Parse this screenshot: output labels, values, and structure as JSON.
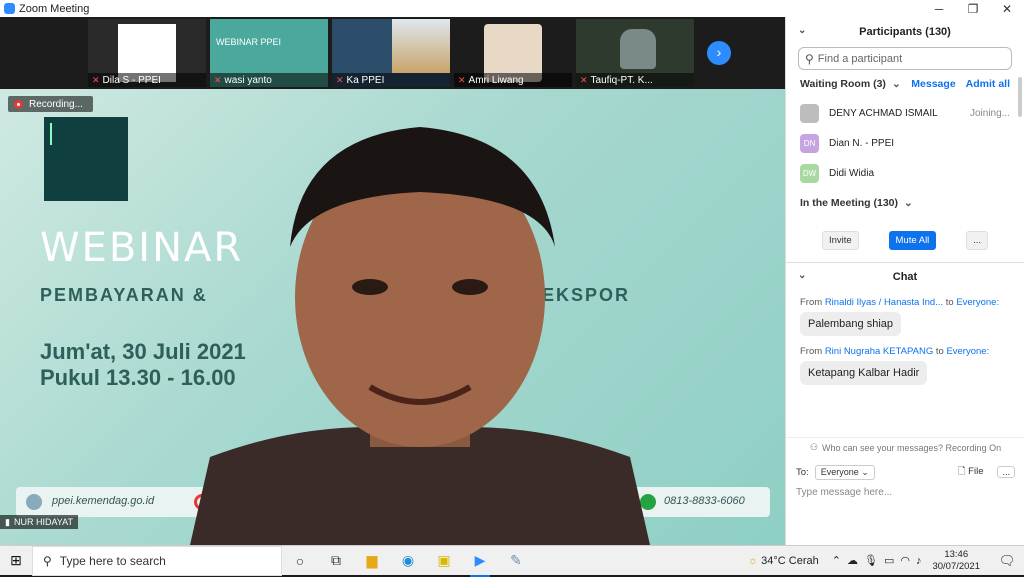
{
  "window": {
    "title": "Zoom Meeting"
  },
  "thumbnails": [
    {
      "name": "Dila S - PPEI",
      "bg": "#222222"
    },
    {
      "name": "wasi yanto",
      "bg": "#4aa89c"
    },
    {
      "name": "Ka PPEI",
      "bg": "#2c4e6a"
    },
    {
      "name": "Amri Liwang",
      "bg": "#bcbcbc"
    },
    {
      "name": "Taufiq-PT. K...",
      "bg": "#2f3a2f"
    }
  ],
  "recording_label": "Recording...",
  "main_video": {
    "slide_title": "WEBINAR",
    "subtitle_left": "PEMBAYARAN &",
    "subtitle_right": "UK EKSPOR",
    "date": "Jum'at, 30 Juli 2021",
    "time": "Pukul 13.30 - 16.00",
    "url": "ppei.kemendag.go.id",
    "phone": "0813-8833-6060",
    "speaker": "NUR HIDAYAT"
  },
  "participants": {
    "header": "Participants (130)",
    "search_placeholder": "Find a participant",
    "waiting_room": "Waiting Room (3)",
    "message_label": "Message",
    "admit_all_label": "Admit all",
    "waiting": [
      {
        "initials": "",
        "name": "DENY ACHMAD ISMAIL",
        "status": "Joining...",
        "color": "#bdbdbd"
      },
      {
        "initials": "DN",
        "name": "Dian N. - PPEI",
        "status": "",
        "color": "#c6a4e0"
      },
      {
        "initials": "DW",
        "name": "Didi Widia",
        "status": "",
        "color": "#a8d9a3"
      }
    ],
    "in_meeting": "In the Meeting (130)",
    "invite_label": "Invite",
    "mute_all_label": "Mute All",
    "more_label": "..."
  },
  "chat": {
    "header": "Chat",
    "messages": [
      {
        "from": "Rinaldi Ilyas / Hanasta Ind...",
        "to": "Everyone:",
        "text": "Palembang shiap"
      },
      {
        "from": "Rini Nugraha KETAPANG",
        "to": "Everyone:",
        "text": "Ketapang Kalbar Hadir"
      }
    ],
    "who_can_see": "Who can see your messages? Recording On",
    "to_label": "To:",
    "to_value": "Everyone",
    "file_label": "File",
    "more_label": "...",
    "placeholder": "Type message here..."
  },
  "taskbar": {
    "search_placeholder": "Type here to search",
    "weather": "34°C  Cerah",
    "time": "13:46",
    "date": "30/07/2021"
  }
}
